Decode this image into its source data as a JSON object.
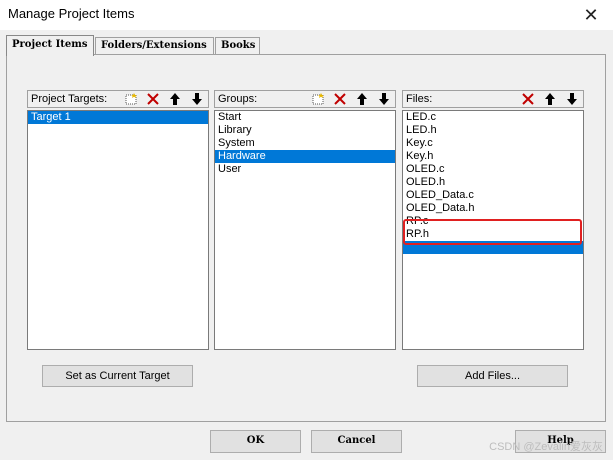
{
  "window": {
    "title": "Manage Project Items",
    "close_glyph": "✕"
  },
  "tabs": [
    {
      "label": "Project Items",
      "active": true
    },
    {
      "label": "Folders/Extensions",
      "active": false
    },
    {
      "label": "Books",
      "active": false
    }
  ],
  "targets_panel": {
    "label": "Project Targets:",
    "items": [
      {
        "label": "Target 1",
        "selected": true
      }
    ]
  },
  "groups_panel": {
    "label": "Groups:",
    "items": [
      {
        "label": "Start",
        "selected": false
      },
      {
        "label": "Library",
        "selected": false
      },
      {
        "label": "System",
        "selected": false
      },
      {
        "label": "Hardware",
        "selected": true
      },
      {
        "label": "User",
        "selected": false
      }
    ]
  },
  "files_panel": {
    "label": "Files:",
    "items": [
      {
        "label": "LED.c",
        "selected": false
      },
      {
        "label": "LED.h",
        "selected": false
      },
      {
        "label": "Key.c",
        "selected": false
      },
      {
        "label": "Key.h",
        "selected": false
      },
      {
        "label": "OLED.c",
        "selected": false
      },
      {
        "label": "OLED.h",
        "selected": false
      },
      {
        "label": "OLED_Data.c",
        "selected": false
      },
      {
        "label": "OLED_Data.h",
        "selected": false
      },
      {
        "label": "RP.c",
        "selected": false
      },
      {
        "label": "RP.h",
        "selected": false
      },
      {
        "label": "",
        "selected": true
      }
    ]
  },
  "buttons": {
    "set_current_target": "Set as Current Target",
    "add_files": "Add Files...",
    "ok": "OK",
    "cancel": "Cancel",
    "help": "Help"
  },
  "watermark": "CSDN @Zevalin爱灰灰",
  "colors": {
    "selection": "#0078d7",
    "highlight_box": "#e02020",
    "delete_icon": "#c00000"
  }
}
